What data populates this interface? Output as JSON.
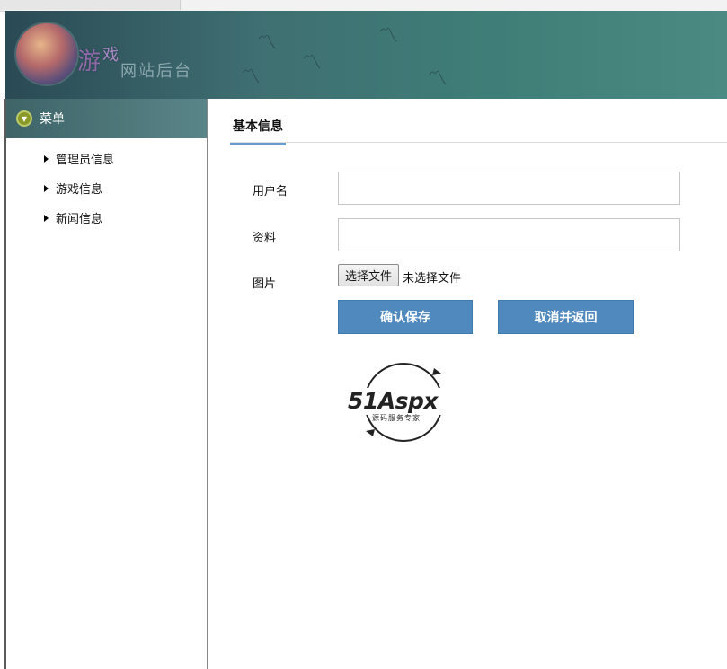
{
  "banner": {
    "brand_line1_main": "游",
    "brand_line1_small": "戏",
    "brand_line2": "网站后台"
  },
  "sidebar": {
    "header_title": "菜单",
    "items": [
      {
        "label": "管理员信息"
      },
      {
        "label": "游戏信息"
      },
      {
        "label": "新闻信息"
      }
    ]
  },
  "main": {
    "section_tab": "基本信息",
    "fields": {
      "username_label": "用户名",
      "username_value": "",
      "profile_label": "资料",
      "profile_value": "",
      "image_label": "图片",
      "file_button": "选择文件",
      "file_status": "未选择文件"
    },
    "buttons": {
      "confirm": "确认保存",
      "cancel": "取消并返回"
    },
    "watermark": {
      "brand": "51Aspx",
      "tagline": "源码服务专家"
    }
  },
  "colors": {
    "accent": "#4f89be",
    "tab_underline": "#6a9bd0",
    "menu_header": "#4a7477"
  }
}
